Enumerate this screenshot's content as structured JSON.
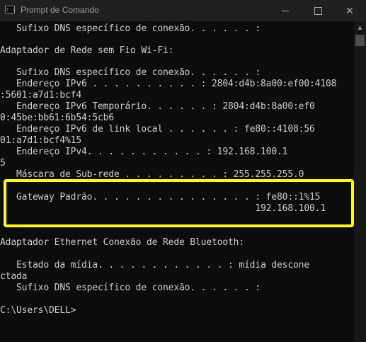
{
  "window": {
    "title": "Prompt de Comando",
    "icon": "cmd-icon",
    "icon_glyph": "C:\\"
  },
  "console": {
    "lines": [
      "   Sufixo DNS específico de conexão. . . . . . :",
      "",
      "Adaptador de Rede sem Fio Wi-Fi:",
      "",
      "   Sufixo DNS específico de conexão. . . . . . :",
      "   Endereço IPv6 . . . . . . . . . . : 2804:d4b:8a00:ef00:4108",
      ":5601:a7d1:bcf4",
      "   Endereço IPv6 Temporário. . . . . . : 2804:d4b:8a00:ef0",
      "0:45be:bb61:6b54:5cb6",
      "   Endereço IPv6 de link local . . . . . . : fe80::4108:56",
      "01:a7d1:bcf4%15",
      "   Endereço IPv4. . . . . . . . . . . : 192.168.100.1",
      "5",
      "   Máscara de Sub-rede . . . . . . . . . : 255.255.255.0",
      "   Gateway Padrão. . . . . . . . . . . . . . . : fe80::1%15",
      "                                               192.168.100.1",
      "",
      "Adaptador Ethernet Conexão de Rede Bluetooth:",
      "",
      "   Estado da mídia. . . . . . . . . . . . : mídia descone",
      "ctada",
      "   Sufixo DNS específico de conexão. . . . . . :",
      "",
      "C:\\Users\\DELL>"
    ]
  },
  "colors": {
    "background": "#0c0c0c",
    "text": "#cccccc",
    "titlebar": "#1f1f1f",
    "highlight": "#ffff00"
  }
}
